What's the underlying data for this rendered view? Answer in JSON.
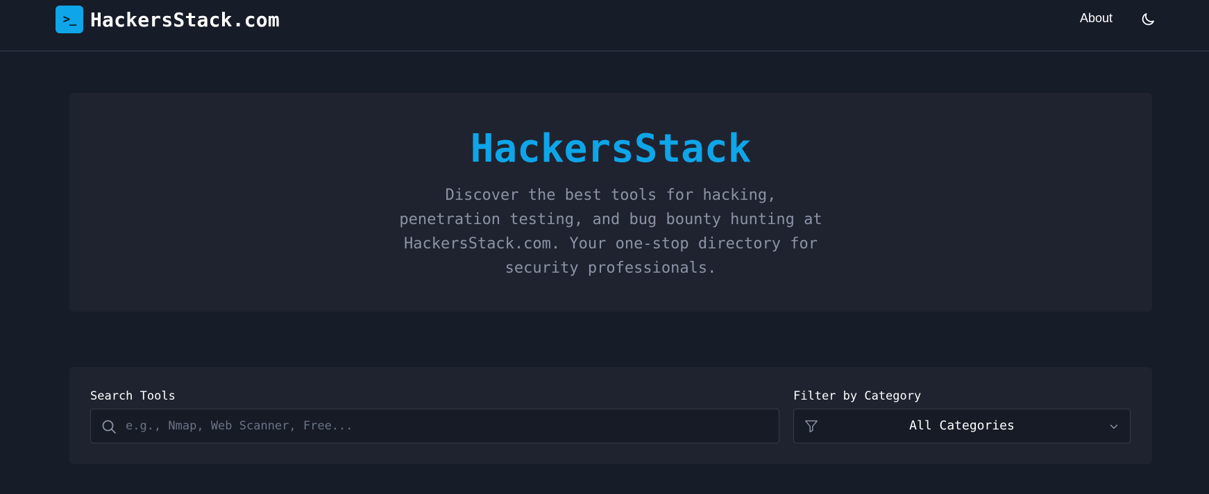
{
  "header": {
    "logo_glyph": ">_",
    "brand_name": "HackersStack.com",
    "nav_about": "About",
    "theme_icon": "moon-icon"
  },
  "hero": {
    "title": "HackersStack",
    "subtitle": "Discover the best tools for hacking, penetration testing, and bug bounty hunting at HackersStack.com. Your one-stop directory for security professionals."
  },
  "search": {
    "label": "Search Tools",
    "placeholder": "e.g., Nmap, Web Scanner, Free...",
    "value": "",
    "icon": "search-icon"
  },
  "filter": {
    "label": "Filter by Category",
    "selected": "All Categories",
    "icon": "filter-icon",
    "dropdown_icon": "chevron-down-icon"
  },
  "colors": {
    "background": "#161c28",
    "card": "#1f232f",
    "accent": "#0ea5e9",
    "muted_text": "#8b93a5"
  }
}
